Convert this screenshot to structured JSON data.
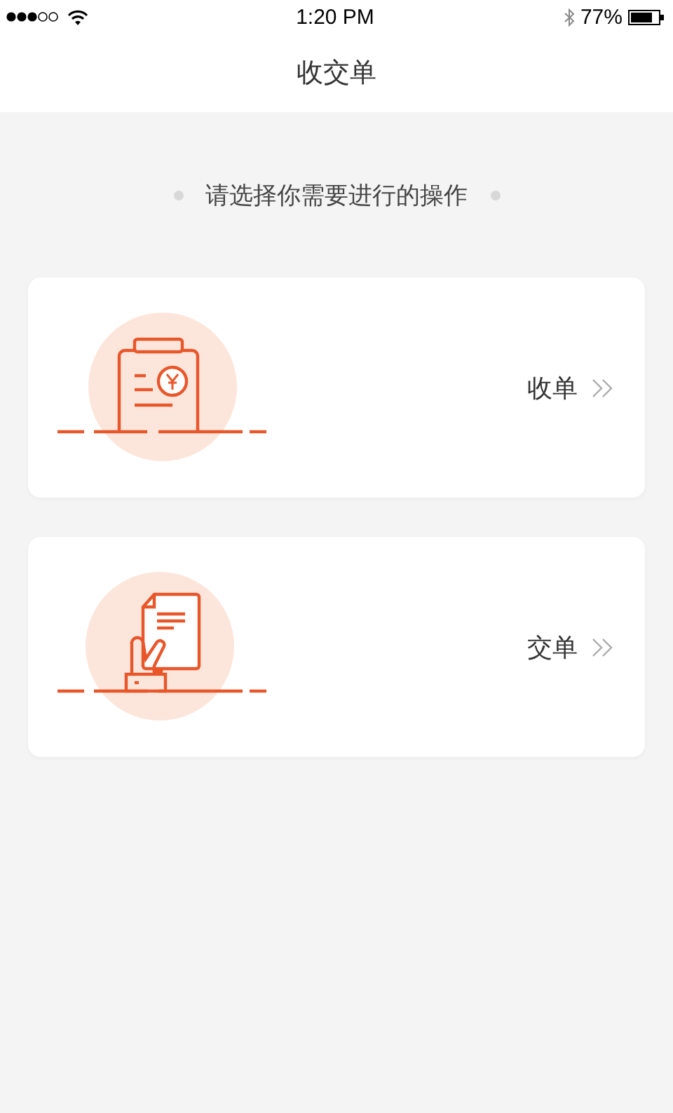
{
  "status_bar": {
    "time": "1:20 PM",
    "battery": "77%"
  },
  "nav_bar": {
    "title": "收交单"
  },
  "prompt": "请选择你需要进行的操作",
  "options": [
    {
      "kind": "receive",
      "label": "收单"
    },
    {
      "kind": "submit",
      "label": "交单"
    }
  ]
}
